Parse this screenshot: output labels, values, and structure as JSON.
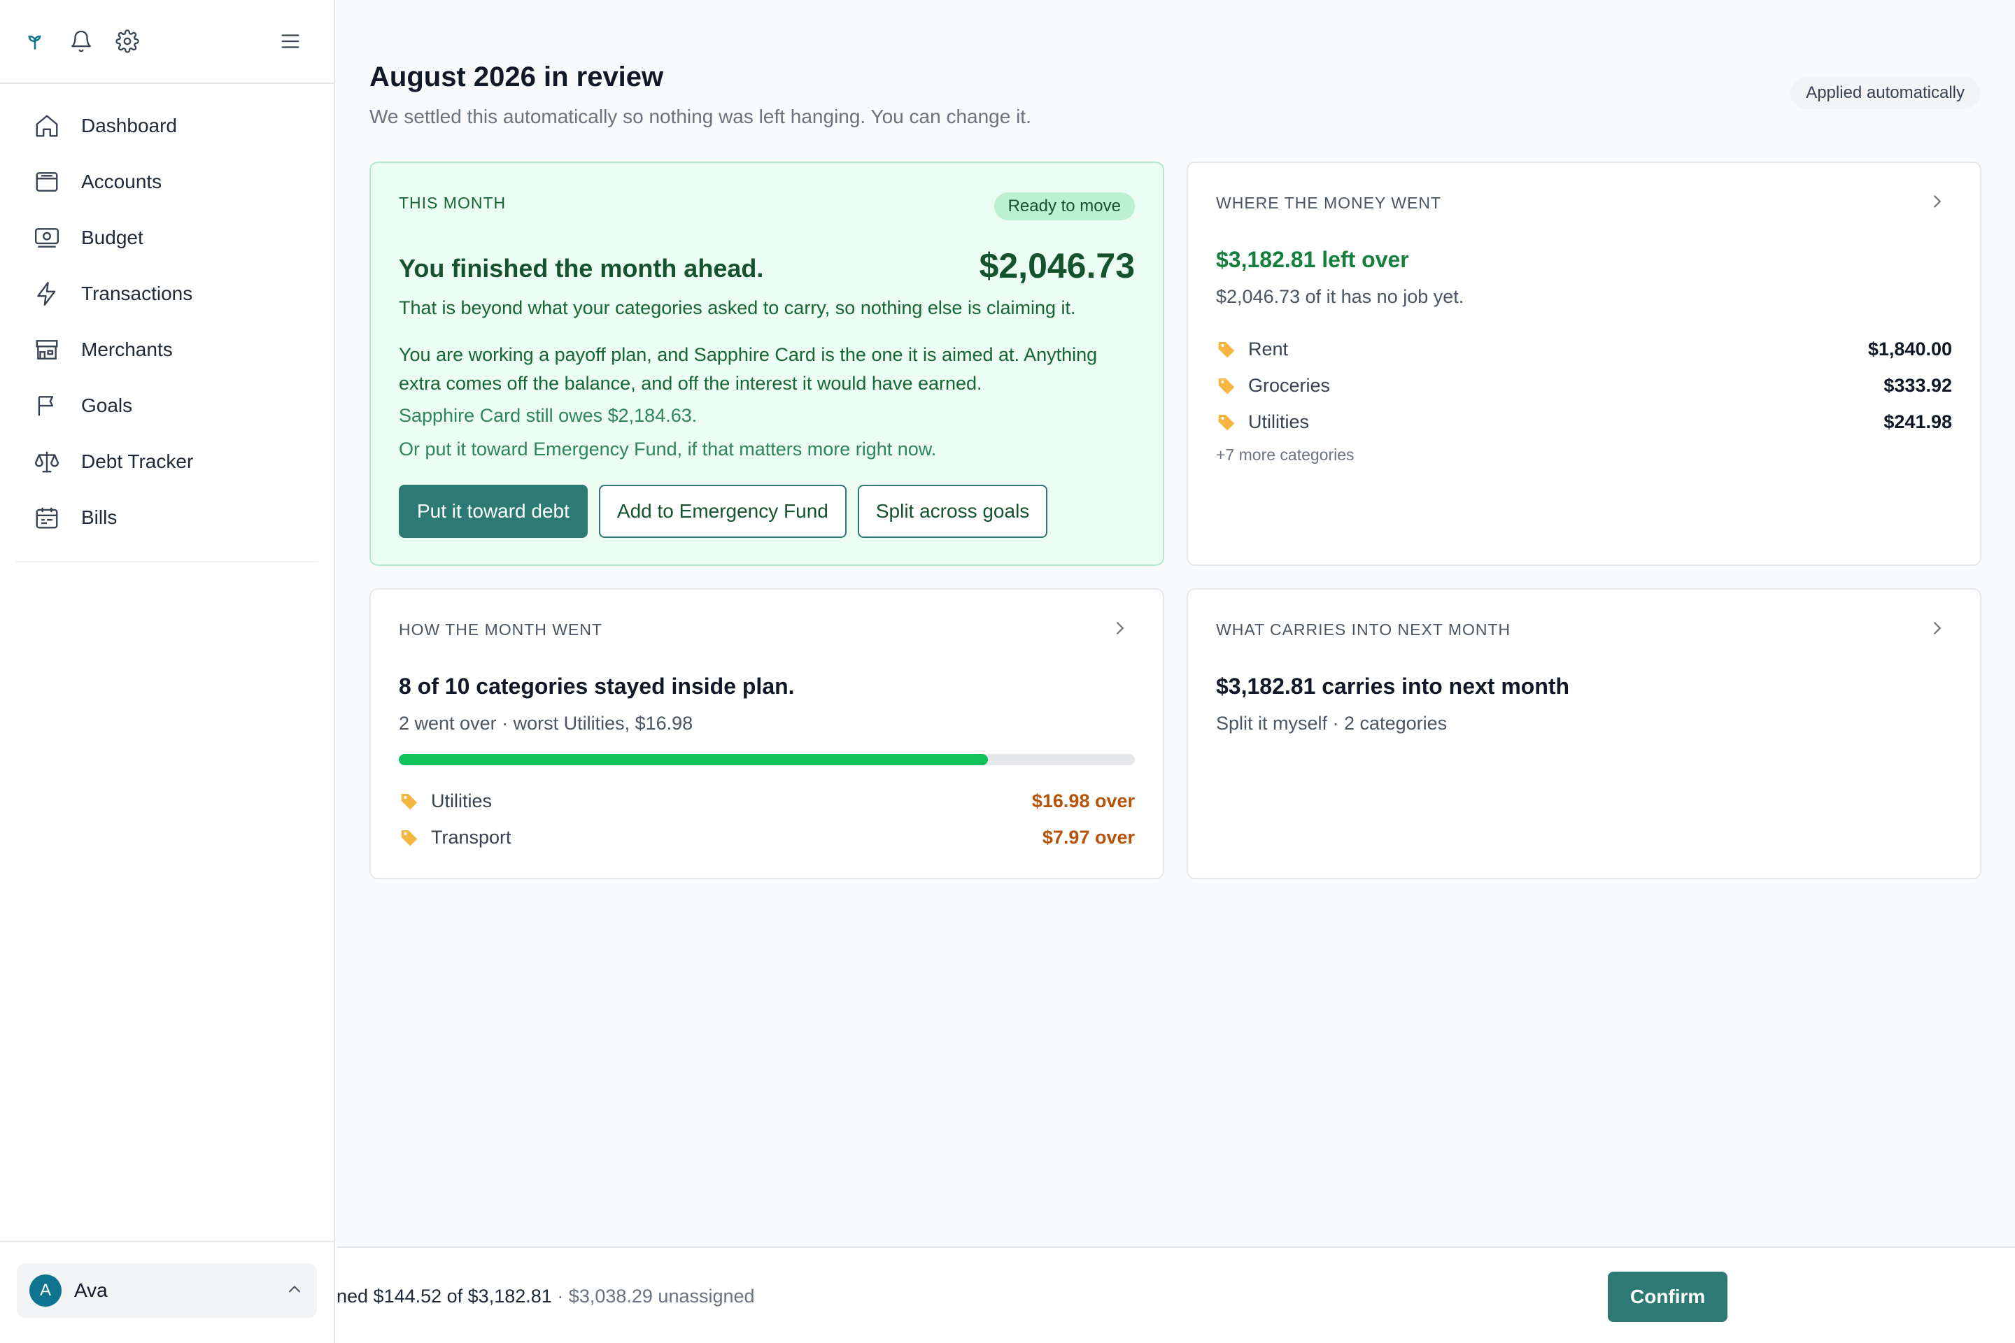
{
  "sidebar": {
    "nav": [
      {
        "label": "Dashboard",
        "icon": "home-icon"
      },
      {
        "label": "Accounts",
        "icon": "wallet-icon"
      },
      {
        "label": "Budget",
        "icon": "banknote-icon"
      },
      {
        "label": "Transactions",
        "icon": "bolt-icon"
      },
      {
        "label": "Merchants",
        "icon": "store-icon"
      },
      {
        "label": "Goals",
        "icon": "flag-icon"
      },
      {
        "label": "Debt Tracker",
        "icon": "scale-icon"
      },
      {
        "label": "Bills",
        "icon": "calendar-icon"
      }
    ],
    "user": {
      "initial": "A",
      "name": "Ava"
    }
  },
  "header": {
    "title": "August 2026 in review",
    "subtitle": "We settled this automatically so nothing was left hanging. You can change it.",
    "badge": "Applied automatically"
  },
  "this_month": {
    "label": "THIS MONTH",
    "badge": "Ready to move",
    "headline": "You finished the month ahead.",
    "amount": "$2,046.73",
    "p1": "That is beyond what your categories asked to carry, so nothing else is claiming it.",
    "p2": "You are working a payoff plan, and Sapphire Card is the one it is aimed at. Anything extra comes off the balance, and off the interest it would have earned.",
    "p3": "Sapphire Card still owes $2,184.63.",
    "p4": "Or put it toward Emergency Fund, if that matters more right now.",
    "buttons": {
      "primary": "Put it toward debt",
      "emergency": "Add to Emergency Fund",
      "split": "Split across goals"
    }
  },
  "money_went": {
    "label": "WHERE THE MONEY WENT",
    "headline": "$3,182.81 left over",
    "sub": "$2,046.73 of it has no job yet.",
    "rows": [
      {
        "name": "Rent",
        "value": "$1,840.00"
      },
      {
        "name": "Groceries",
        "value": "$333.92"
      },
      {
        "name": "Utilities",
        "value": "$241.98"
      }
    ],
    "more": "+7 more categories"
  },
  "month_went": {
    "label": "HOW THE MONTH WENT",
    "headline": "8 of 10 categories stayed inside plan.",
    "sub": "2 went over · worst Utilities, $16.98",
    "progress": 0.8,
    "rows": [
      {
        "name": "Utilities",
        "value": "$16.98 over"
      },
      {
        "name": "Transport",
        "value": "$7.97 over"
      }
    ]
  },
  "carries": {
    "label": "WHAT CARRIES INTO NEXT MONTH",
    "headline": "$3,182.81 carries into next month",
    "sub": "Split it myself · 2 categories"
  },
  "footer": {
    "assigned": "ned $144.52 of $3,182.81",
    "unassigned": "· $3,038.29 unassigned",
    "confirm": "Confirm"
  },
  "colors": {
    "accent": "#2c7a73",
    "positive": "#15803d",
    "warning": "#b45309",
    "progress": "#10c25a"
  }
}
